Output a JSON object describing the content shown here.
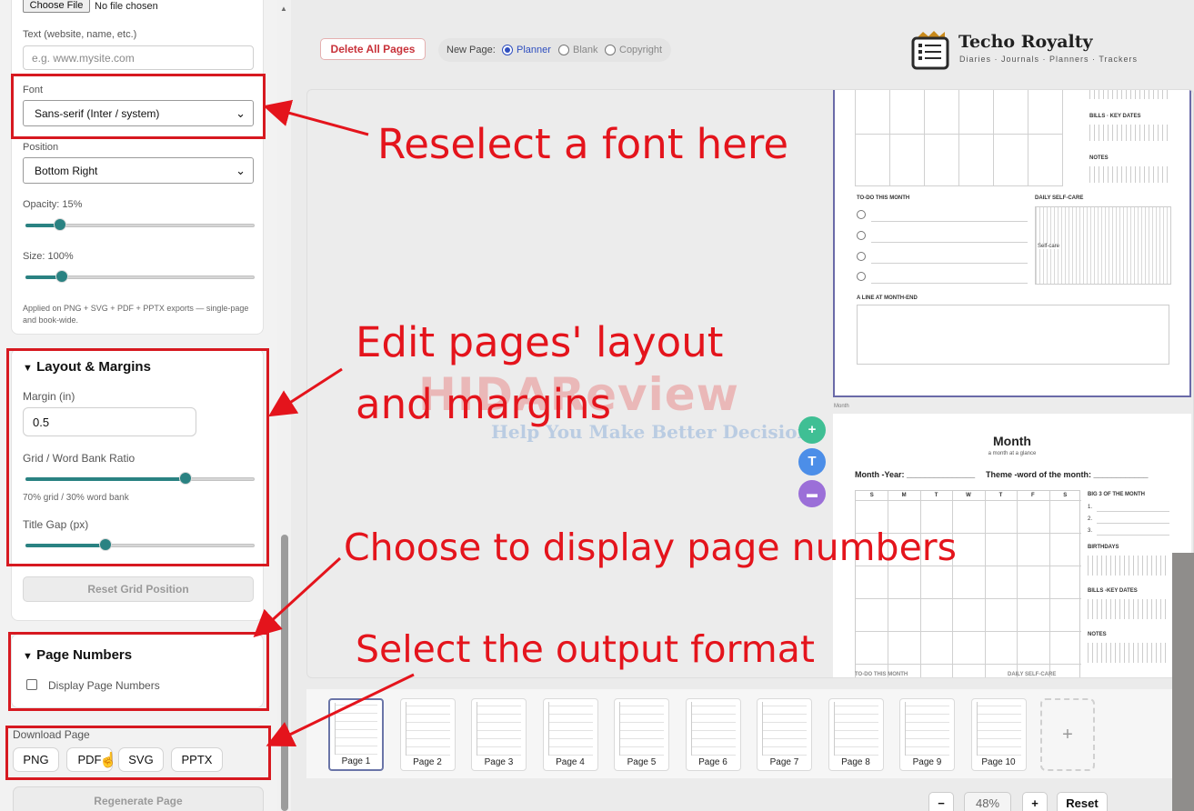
{
  "sidebar": {
    "file": {
      "button": "Choose File",
      "status": "No file chosen"
    },
    "text_label": "Text (website, name, etc.)",
    "text_placeholder": "e.g. www.mysite.com",
    "font_label": "Font",
    "font_value": "Sans-serif (Inter / system)",
    "position_label": "Position",
    "position_value": "Bottom Right",
    "opacity_label": "Opacity: 15%",
    "opacity_value": 0.15,
    "size_label": "Size: 100%",
    "size_value": 1.0,
    "applied_note": "Applied on PNG + SVG + PDF + PPTX exports — single-page and book-wide.",
    "layout": {
      "heading": "Layout & Margins",
      "margin_label": "Margin (in)",
      "margin_value": "0.5",
      "ratio_label": "Grid / Word Bank Ratio",
      "ratio_value": 0.7,
      "ratio_note": "70% grid / 30% word bank",
      "title_gap_label": "Title Gap (px)",
      "title_gap_value": 0.35,
      "reset_button": "Reset Grid Position"
    },
    "page_numbers": {
      "heading": "Page Numbers",
      "checkbox_label": "Display Page Numbers",
      "checked": false
    },
    "download": {
      "label": "Download Page",
      "formats": [
        "PNG",
        "PDF",
        "SVG",
        "PPTX"
      ]
    },
    "regenerate_button": "Regenerate Page"
  },
  "toolbar": {
    "delete_all": "Delete All Pages",
    "new_page_label": "New Page:",
    "options": [
      "Planner",
      "Blank",
      "Copyright"
    ],
    "selected": "Planner"
  },
  "brand": {
    "name": "Techo Royalty",
    "tagline": "Diaries · Journals · Planners · Trackers"
  },
  "page1_preview": {
    "bills": "BILLS · KEY DATES",
    "notes": "NOTES",
    "todo": "TO-DO THIS MONTH",
    "selfcare": "DAILY SELF-CARE",
    "selfcare_side": "Self-care",
    "month_end": "A LINE AT MONTH-END"
  },
  "page2_preview": {
    "tag": "Month",
    "title": "Month",
    "subtitle": "a month at a glance",
    "month_year": "Month -Year: _______________",
    "theme": "Theme -word of the month: ____________",
    "days": [
      "S",
      "M",
      "T",
      "W",
      "T",
      "F",
      "S"
    ],
    "big3": "BIG 3 OF THE MONTH",
    "big3_items": [
      "1.",
      "2.",
      "3."
    ],
    "birthdays": "BIRTHDAYS",
    "bills": "BILLS -KEY DATES",
    "notes": "NOTES",
    "todo": "TO-DO THIS MONTH",
    "selfcare": "DAILY SELF-CARE"
  },
  "fabs": [
    {
      "icon": "plus-icon",
      "glyph": "+",
      "color": "#3fbf94"
    },
    {
      "icon": "text-icon",
      "glyph": "T",
      "color": "#4c8ee8"
    },
    {
      "icon": "frame-icon",
      "glyph": "▬",
      "color": "#9b6fd8"
    }
  ],
  "thumbnails": [
    "Page 1",
    "Page 2",
    "Page 3",
    "Page 4",
    "Page 5",
    "Page 6",
    "Page 7",
    "Page 8",
    "Page 9",
    "Page 10"
  ],
  "active_thumbnail": "Page 1",
  "add_page_glyph": "+",
  "zoom": {
    "minus": "−",
    "value": "48%",
    "plus": "+",
    "reset": "Reset"
  },
  "watermark": {
    "title": "HIDAReview",
    "subtitle": "Help You Make Better Decisions"
  },
  "annotations": {
    "font": "Reselect a font here",
    "layout_line1": "Edit pages' layout",
    "layout_line2": "and margins",
    "page_numbers": "Choose to display page numbers",
    "output": "Select the output format"
  },
  "colors": {
    "accent": "#2a8282",
    "annotation": "#e4141c",
    "delete": "#c8323a",
    "radio": "#2f4fbf"
  }
}
